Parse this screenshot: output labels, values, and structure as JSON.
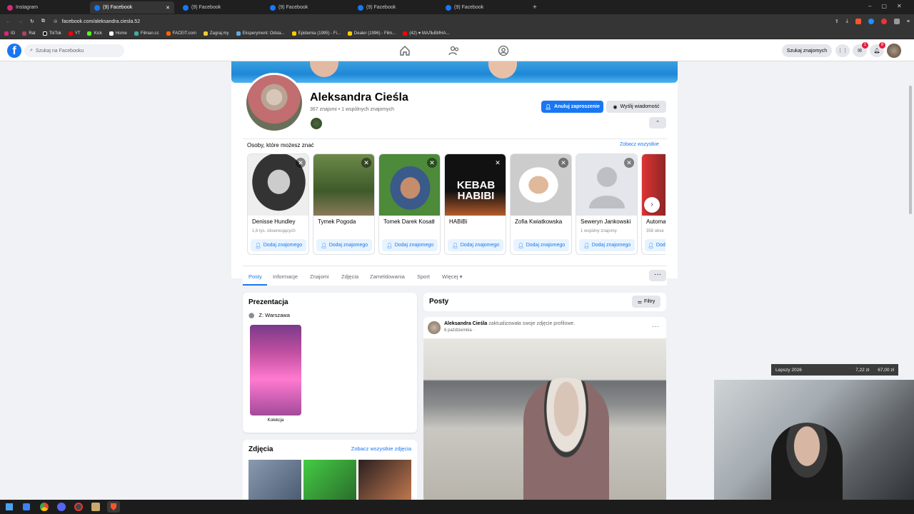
{
  "browser": {
    "tabs": [
      {
        "label": "Instagram",
        "active": false
      },
      {
        "label": "(9) Facebook",
        "active": true
      },
      {
        "label": "(9) Facebook",
        "active": false
      },
      {
        "label": "(9) Facebook",
        "active": false
      },
      {
        "label": "(9) Facebook",
        "active": false
      },
      {
        "label": "(9) Facebook",
        "active": false
      }
    ],
    "new_tab": "+",
    "url": "facebook.com/aleksandra.ciesla.52",
    "bookmarks": [
      "IG",
      "Rat",
      "TikTok",
      "YT",
      "Kick",
      "Home",
      "Filman.cc",
      "FACEIT.com",
      "Zagraj.my",
      "Eksperyment: Odsia...",
      "Epidemia (1995) - Fi...",
      "Dealer (1996) - Film...",
      "(42) ♥ МАЛЬВИНА..."
    ]
  },
  "fbnav": {
    "logo": "f",
    "search_placeholder": "Szukaj na Facebooku",
    "find_friends": "Szukaj znajomych",
    "messenger_badge": "1",
    "notif_badge": "8"
  },
  "profile": {
    "name": "Aleksandra Cieśla",
    "meta": "367 znajomi • 1 wspólnych znajomych",
    "cancel_request": "Anuluj zaproszenie",
    "send_message": "Wyślij wiadomość"
  },
  "pymk": {
    "title": "Osoby, które możesz znać",
    "see_all": "Zobacz wszystkie",
    "add_label": "Dodaj znajomego",
    "cards": [
      {
        "name": "Denisse Hundley",
        "sub": "1,6 tys. obserwujących"
      },
      {
        "name": "Tymek Pogoda",
        "sub": ""
      },
      {
        "name": "Tomek Darek Kosatł",
        "sub": ""
      },
      {
        "name": "HABiBi",
        "sub": ""
      },
      {
        "name": "Zofia Kwiatkowska",
        "sub": ""
      },
      {
        "name": "Seweryn Jankowski",
        "sub": "1 wspólny znajomy"
      },
      {
        "name": "Automa",
        "sub": "358 obse"
      }
    ],
    "habibi_img_text": "KEBAB HABIBI"
  },
  "profile_tabs": [
    "Posty",
    "Informacje",
    "Znajomi",
    "Zdjęcia",
    "Zameldowania",
    "Sport",
    "Więcej"
  ],
  "intro": {
    "title": "Prezentacja",
    "location": "Z: Warszawa",
    "collection": "Kolekcja"
  },
  "photos": {
    "title": "Zdjęcia",
    "see_all": "Zobacz wszystkie zdjęcia"
  },
  "posts": {
    "title": "Posty",
    "filters": "Filtry",
    "post_author": "Aleksandra Cieśla",
    "post_action": "zaktualizowała swoje zdjęcie profilowe.",
    "post_date": "6 października ·"
  },
  "overlay": {
    "label": "Lepszy 2026",
    "value1": "7,22 zł",
    "value2": "67,00 zł"
  },
  "colors": {
    "fb_blue": "#1877f2",
    "page_bg": "#f0f2f5"
  }
}
